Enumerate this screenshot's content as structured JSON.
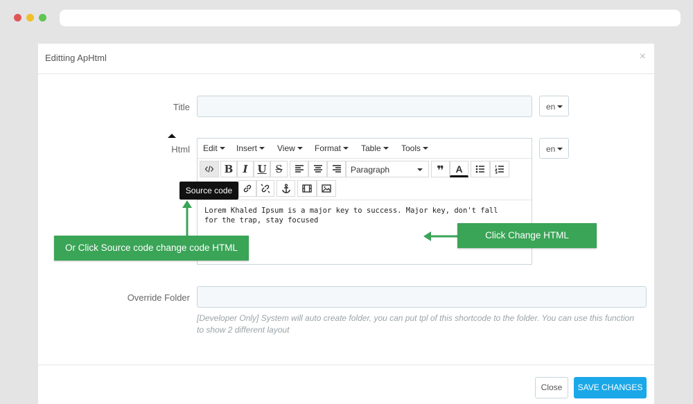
{
  "modal": {
    "title": "Editting ApHtml",
    "close_symbol": "×"
  },
  "form": {
    "title_label": "Title",
    "title_value": "",
    "title_lang": "en",
    "html_label": "Html",
    "html_lang": "en",
    "override_label": "Override Folder",
    "override_value": "",
    "override_help": "[Developer Only] System will auto create folder, you can put tpl of this shortcode to the folder. You can use this function to show 2 different layout"
  },
  "editor": {
    "menus": [
      "Edit",
      "Insert",
      "View",
      "Format",
      "Table",
      "Tools"
    ],
    "block_format": "Paragraph",
    "content": "Lorem Khaled Ipsum is a major key to success. Major key, don't fall for the trap, stay focused",
    "tooltip": "Source code",
    "toolbar_icons": [
      "source-code-icon",
      "bold-icon",
      "italic-icon",
      "underline-icon",
      "strikethrough-icon",
      "align-left-icon",
      "align-center-icon",
      "align-right-icon",
      "blockquote-icon",
      "text-color-icon",
      "bullet-list-icon",
      "numbered-list-icon",
      "link-icon",
      "unlink-icon",
      "anchor-icon",
      "media-icon",
      "image-icon"
    ]
  },
  "annotations": {
    "source_code_hint": "Or Click Source code change code HTML",
    "change_html_hint": "Click Change HTML",
    "color": "#3aa457"
  },
  "footer": {
    "close_label": "Close",
    "save_label": "SAVE CHANGES"
  }
}
